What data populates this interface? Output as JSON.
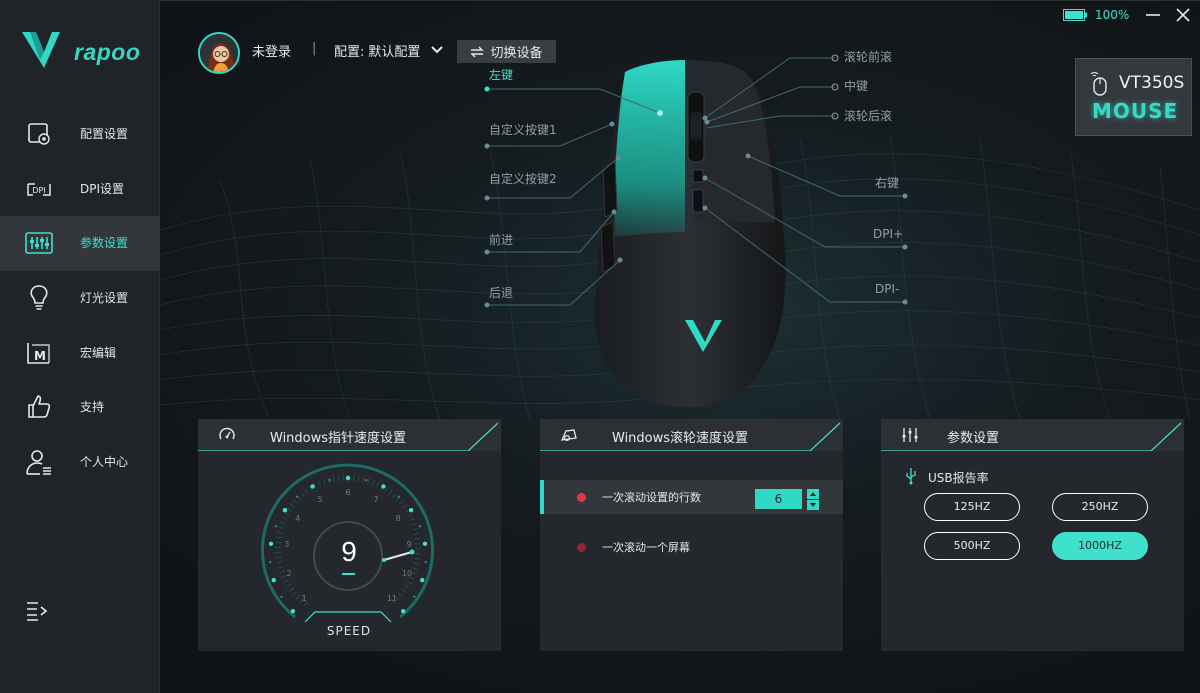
{
  "sidebar": {
    "logo": "rapoo",
    "items": [
      {
        "label": "配置设置",
        "icon": "config-icon",
        "active": false
      },
      {
        "label": "DPI设置",
        "icon": "dpi-icon",
        "active": false
      },
      {
        "label": "参数设置",
        "icon": "sliders-icon",
        "active": true
      },
      {
        "label": "灯光设置",
        "icon": "lightbulb-icon",
        "active": false
      },
      {
        "label": "宏编辑",
        "icon": "macro-icon",
        "active": false
      },
      {
        "label": "支持",
        "icon": "thumbs-up-icon",
        "active": false
      },
      {
        "label": "个人中心",
        "icon": "user-icon",
        "active": false
      }
    ]
  },
  "header": {
    "login": "未登录",
    "separator": "|",
    "profile_label": "配置:",
    "profile_value": "默认配置",
    "switch_device": "切换设备"
  },
  "status": {
    "battery": "100%",
    "battery_color": "#3fe0cc"
  },
  "device": {
    "name": "VT350S",
    "type": "MOUSE"
  },
  "callouts": {
    "left_click": "左键",
    "custom1": "自定义按键1",
    "custom2": "自定义按键2",
    "forward": "前进",
    "back": "后退",
    "scroll_up": "滚轮前滚",
    "middle": "中键",
    "scroll_down": "滚轮后滚",
    "right_click": "右键",
    "dpi_up": "DPI+",
    "dpi_down": "DPI-"
  },
  "pointer_panel": {
    "title": "Windows指针速度设置",
    "speed": "9",
    "speed_label": "SPEED",
    "ticks": [
      "1",
      "2",
      "3",
      "4",
      "5",
      "6",
      "7",
      "8",
      "9",
      "10",
      "11"
    ],
    "speed_min": 1,
    "speed_max": 11
  },
  "scroll_panel": {
    "title": "Windows滚轮速度设置",
    "rows": [
      {
        "label": "一次滚动设置的行数",
        "selected": true,
        "dot_color": "#e0384b"
      },
      {
        "label": "一次滚动一个屏幕",
        "selected": false,
        "dot_color": "#8a2a35"
      }
    ],
    "lines_value": "6"
  },
  "param_panel": {
    "title": "参数设置",
    "usb_label": "USB报告率",
    "rates": [
      {
        "label": "125HZ",
        "active": false
      },
      {
        "label": "250HZ",
        "active": false
      },
      {
        "label": "500HZ",
        "active": false
      },
      {
        "label": "1000HZ",
        "active": true
      }
    ]
  },
  "colors": {
    "accent": "#3fe0cc",
    "panel": "#24282c",
    "sidebar": "#202327"
  }
}
